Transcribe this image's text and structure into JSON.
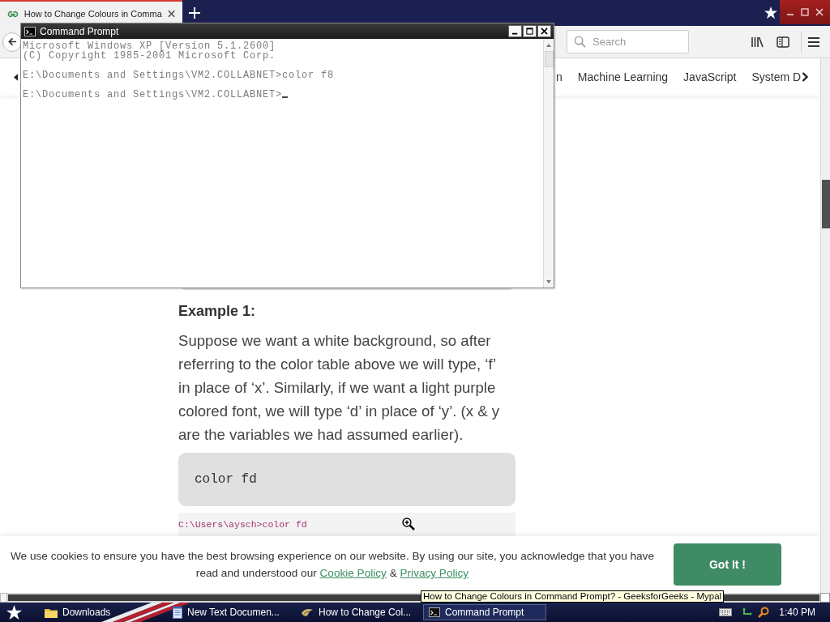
{
  "browser": {
    "tabs": [
      {
        "title": "How to Change Colours in Comma",
        "selected": true
      }
    ],
    "search": {
      "placeholder": "Search"
    },
    "nav": {
      "items": [
        {
          "label": "n"
        },
        {
          "label": "Machine Learning"
        },
        {
          "label": "JavaScript"
        },
        {
          "label": "System D"
        }
      ]
    },
    "article": {
      "heading": "Example 1:",
      "paragraph": "Suppose we want a white background, so after referring to the color table above we will type, ‘f’ in place of ‘x’. Similarly, if we want a light purple colored font, we will type ‘d’ in place of ‘y’. (x & y are the variables we had assumed earlier).",
      "code": "color fd",
      "output": "C:\\Users\\aysch>color fd"
    },
    "cookie_banner": {
      "text": "We use cookies to ensure you have the best browsing experience on our website. By using our site, you acknowledge that you have read and understood our",
      "links": [
        {
          "label": "Cookie Policy"
        },
        {
          "label": "Privacy Policy"
        }
      ],
      "joiner": "&",
      "button": "Got It !"
    },
    "tooltip": "How to Change Colours in Command Prompt? - GeeksforGeeks - Mypal"
  },
  "console_window": {
    "title": "Command Prompt",
    "blocks": [
      {
        "lines": [
          "Microsoft Windows XP [Version 5.1.2600]",
          "(C) Copyright 1985-2001 Microsoft Corp."
        ]
      },
      {
        "lines": [
          "E:\\Documents and Settings\\VM2.COLLABNET>color f8"
        ]
      },
      {
        "lines": [
          "E:\\Documents and Settings\\VM2.COLLABNET>"
        ]
      }
    ]
  },
  "taskbar": {
    "items": [
      {
        "label": "Downloads",
        "kind": "folder",
        "selected": false
      },
      {
        "label": "New Text Documen...",
        "kind": "notepad",
        "selected": false
      },
      {
        "label": "How to Change Col...",
        "kind": "browser",
        "selected": false
      },
      {
        "label": "Command Prompt",
        "kind": "console",
        "selected": true
      }
    ],
    "clock": "1:40 PM"
  }
}
